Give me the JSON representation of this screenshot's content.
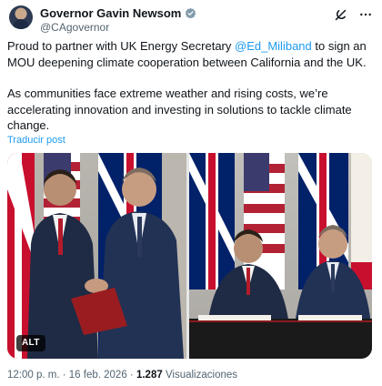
{
  "author": {
    "display_name": "Governor Gavin Newsom",
    "handle": "@CAgovernor",
    "verified_color": "#829aab"
  },
  "header_icons": [
    "grok-icon",
    "more-icon"
  ],
  "tweet": {
    "paragraph1_pre": "Proud to partner with UK Energy Secretary ",
    "mention": "@Ed_Miliband",
    "paragraph1_post": " to sign an MOU deepening climate cooperation between California and the UK.",
    "paragraph2": "As communities face extreme weather and rising costs, we’re accelerating innovation and investing in solutions to tackle climate change.",
    "translate_label": "Traducir post"
  },
  "media": {
    "alt_badge": "ALT",
    "photos": [
      {
        "description_icon": "handshake-photo"
      },
      {
        "description_icon": "signing-photo"
      }
    ]
  },
  "meta": {
    "time": "12:00 p. m.",
    "separator": " · ",
    "date": "16 feb. 2026",
    "views_count": "1.287",
    "views_label": " Visualizaciones"
  },
  "colors": {
    "link": "#1d9bf0",
    "secondary_text": "#536471",
    "text": "#0f1419"
  }
}
